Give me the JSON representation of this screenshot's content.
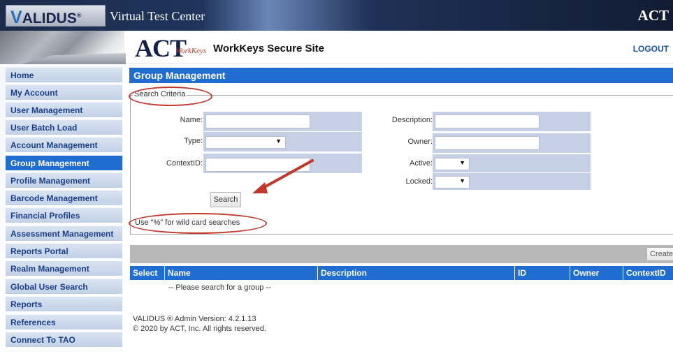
{
  "app": {
    "brand": "VALIDUS",
    "brand_mark": "®",
    "title": "Virtual Test Center",
    "top_logo": "ACT"
  },
  "header": {
    "act_logo": "ACT",
    "workkeys_logo": "WorkKeys",
    "site_title": "WorkKeys Secure Site",
    "logout": "LOGOUT"
  },
  "sidebar": {
    "items": [
      {
        "label": "Home"
      },
      {
        "label": "My Account"
      },
      {
        "label": "User Management"
      },
      {
        "label": "User Batch Load"
      },
      {
        "label": "Account Management"
      },
      {
        "label": "Group Management"
      },
      {
        "label": "Profile Management"
      },
      {
        "label": "Barcode Management"
      },
      {
        "label": "Financial Profiles"
      },
      {
        "label": "Assessment Management"
      },
      {
        "label": "Reports Portal"
      },
      {
        "label": "Realm Management"
      },
      {
        "label": "Global User Search"
      },
      {
        "label": "Reports"
      },
      {
        "label": "References"
      },
      {
        "label": "Connect To TAO"
      }
    ],
    "active": "Group Management"
  },
  "main": {
    "title": "Group Management",
    "search_criteria": {
      "legend": "Search Criteria",
      "name_label": "Name:",
      "name_value": "",
      "type_label": "Type:",
      "type_value": "",
      "context_label": "ContextID:",
      "context_value": "",
      "description_label": "Description:",
      "description_value": "",
      "owner_label": "Owner:",
      "owner_value": "",
      "active_label": "Active:",
      "active_value": "",
      "locked_label": "Locked:",
      "locked_value": "",
      "search_button": "Search",
      "wildcard_note": "Use \"%\" for wild card searches"
    },
    "create_button": "Create",
    "table": {
      "columns": [
        "Select",
        "Name",
        "Description",
        "ID",
        "Owner",
        "ContextID"
      ],
      "empty_message": "-- Please search for a group --"
    },
    "footer": {
      "version": "VALIDUS ® Admin Version: 4.2.1.13",
      "copyright": "© 2020 by ACT, Inc. All rights reserved."
    }
  },
  "colors": {
    "accent_blue": "#1f6dd0",
    "sidebar_bg": "#c2d1e8",
    "field_bg": "#c5cfe6",
    "annotation_red": "#c0392b"
  },
  "icons": {
    "dropdown": "chevron-down-icon",
    "arrow": "red-arrow-annotation"
  }
}
